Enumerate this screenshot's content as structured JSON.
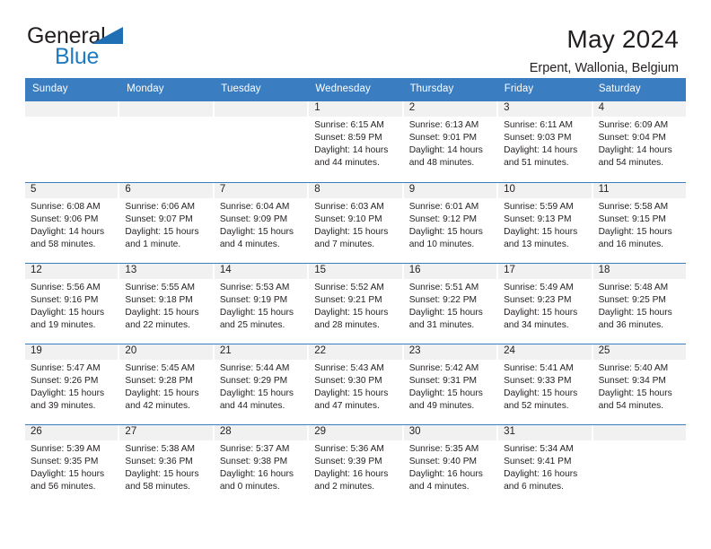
{
  "brand": {
    "name_part1": "General",
    "name_part2": "Blue",
    "triangle_color": "#1f6fb5",
    "blue_color": "#1f7ac0"
  },
  "header": {
    "title": "May 2024",
    "subtitle": "Erpent, Wallonia, Belgium"
  },
  "theme": {
    "header_bar_color": "#3a7dc0",
    "day_band_color": "#f1f1f1",
    "text_color": "#231f20"
  },
  "weekdays": [
    "Sunday",
    "Monday",
    "Tuesday",
    "Wednesday",
    "Thursday",
    "Friday",
    "Saturday"
  ],
  "weeks": [
    [
      {
        "day": "",
        "sunrise": "",
        "sunset": "",
        "daylight1": "",
        "daylight2": ""
      },
      {
        "day": "",
        "sunrise": "",
        "sunset": "",
        "daylight1": "",
        "daylight2": ""
      },
      {
        "day": "",
        "sunrise": "",
        "sunset": "",
        "daylight1": "",
        "daylight2": ""
      },
      {
        "day": "1",
        "sunrise": "Sunrise: 6:15 AM",
        "sunset": "Sunset: 8:59 PM",
        "daylight1": "Daylight: 14 hours",
        "daylight2": "and 44 minutes."
      },
      {
        "day": "2",
        "sunrise": "Sunrise: 6:13 AM",
        "sunset": "Sunset: 9:01 PM",
        "daylight1": "Daylight: 14 hours",
        "daylight2": "and 48 minutes."
      },
      {
        "day": "3",
        "sunrise": "Sunrise: 6:11 AM",
        "sunset": "Sunset: 9:03 PM",
        "daylight1": "Daylight: 14 hours",
        "daylight2": "and 51 minutes."
      },
      {
        "day": "4",
        "sunrise": "Sunrise: 6:09 AM",
        "sunset": "Sunset: 9:04 PM",
        "daylight1": "Daylight: 14 hours",
        "daylight2": "and 54 minutes."
      }
    ],
    [
      {
        "day": "5",
        "sunrise": "Sunrise: 6:08 AM",
        "sunset": "Sunset: 9:06 PM",
        "daylight1": "Daylight: 14 hours",
        "daylight2": "and 58 minutes."
      },
      {
        "day": "6",
        "sunrise": "Sunrise: 6:06 AM",
        "sunset": "Sunset: 9:07 PM",
        "daylight1": "Daylight: 15 hours",
        "daylight2": "and 1 minute."
      },
      {
        "day": "7",
        "sunrise": "Sunrise: 6:04 AM",
        "sunset": "Sunset: 9:09 PM",
        "daylight1": "Daylight: 15 hours",
        "daylight2": "and 4 minutes."
      },
      {
        "day": "8",
        "sunrise": "Sunrise: 6:03 AM",
        "sunset": "Sunset: 9:10 PM",
        "daylight1": "Daylight: 15 hours",
        "daylight2": "and 7 minutes."
      },
      {
        "day": "9",
        "sunrise": "Sunrise: 6:01 AM",
        "sunset": "Sunset: 9:12 PM",
        "daylight1": "Daylight: 15 hours",
        "daylight2": "and 10 minutes."
      },
      {
        "day": "10",
        "sunrise": "Sunrise: 5:59 AM",
        "sunset": "Sunset: 9:13 PM",
        "daylight1": "Daylight: 15 hours",
        "daylight2": "and 13 minutes."
      },
      {
        "day": "11",
        "sunrise": "Sunrise: 5:58 AM",
        "sunset": "Sunset: 9:15 PM",
        "daylight1": "Daylight: 15 hours",
        "daylight2": "and 16 minutes."
      }
    ],
    [
      {
        "day": "12",
        "sunrise": "Sunrise: 5:56 AM",
        "sunset": "Sunset: 9:16 PM",
        "daylight1": "Daylight: 15 hours",
        "daylight2": "and 19 minutes."
      },
      {
        "day": "13",
        "sunrise": "Sunrise: 5:55 AM",
        "sunset": "Sunset: 9:18 PM",
        "daylight1": "Daylight: 15 hours",
        "daylight2": "and 22 minutes."
      },
      {
        "day": "14",
        "sunrise": "Sunrise: 5:53 AM",
        "sunset": "Sunset: 9:19 PM",
        "daylight1": "Daylight: 15 hours",
        "daylight2": "and 25 minutes."
      },
      {
        "day": "15",
        "sunrise": "Sunrise: 5:52 AM",
        "sunset": "Sunset: 9:21 PM",
        "daylight1": "Daylight: 15 hours",
        "daylight2": "and 28 minutes."
      },
      {
        "day": "16",
        "sunrise": "Sunrise: 5:51 AM",
        "sunset": "Sunset: 9:22 PM",
        "daylight1": "Daylight: 15 hours",
        "daylight2": "and 31 minutes."
      },
      {
        "day": "17",
        "sunrise": "Sunrise: 5:49 AM",
        "sunset": "Sunset: 9:23 PM",
        "daylight1": "Daylight: 15 hours",
        "daylight2": "and 34 minutes."
      },
      {
        "day": "18",
        "sunrise": "Sunrise: 5:48 AM",
        "sunset": "Sunset: 9:25 PM",
        "daylight1": "Daylight: 15 hours",
        "daylight2": "and 36 minutes."
      }
    ],
    [
      {
        "day": "19",
        "sunrise": "Sunrise: 5:47 AM",
        "sunset": "Sunset: 9:26 PM",
        "daylight1": "Daylight: 15 hours",
        "daylight2": "and 39 minutes."
      },
      {
        "day": "20",
        "sunrise": "Sunrise: 5:45 AM",
        "sunset": "Sunset: 9:28 PM",
        "daylight1": "Daylight: 15 hours",
        "daylight2": "and 42 minutes."
      },
      {
        "day": "21",
        "sunrise": "Sunrise: 5:44 AM",
        "sunset": "Sunset: 9:29 PM",
        "daylight1": "Daylight: 15 hours",
        "daylight2": "and 44 minutes."
      },
      {
        "day": "22",
        "sunrise": "Sunrise: 5:43 AM",
        "sunset": "Sunset: 9:30 PM",
        "daylight1": "Daylight: 15 hours",
        "daylight2": "and 47 minutes."
      },
      {
        "day": "23",
        "sunrise": "Sunrise: 5:42 AM",
        "sunset": "Sunset: 9:31 PM",
        "daylight1": "Daylight: 15 hours",
        "daylight2": "and 49 minutes."
      },
      {
        "day": "24",
        "sunrise": "Sunrise: 5:41 AM",
        "sunset": "Sunset: 9:33 PM",
        "daylight1": "Daylight: 15 hours",
        "daylight2": "and 52 minutes."
      },
      {
        "day": "25",
        "sunrise": "Sunrise: 5:40 AM",
        "sunset": "Sunset: 9:34 PM",
        "daylight1": "Daylight: 15 hours",
        "daylight2": "and 54 minutes."
      }
    ],
    [
      {
        "day": "26",
        "sunrise": "Sunrise: 5:39 AM",
        "sunset": "Sunset: 9:35 PM",
        "daylight1": "Daylight: 15 hours",
        "daylight2": "and 56 minutes."
      },
      {
        "day": "27",
        "sunrise": "Sunrise: 5:38 AM",
        "sunset": "Sunset: 9:36 PM",
        "daylight1": "Daylight: 15 hours",
        "daylight2": "and 58 minutes."
      },
      {
        "day": "28",
        "sunrise": "Sunrise: 5:37 AM",
        "sunset": "Sunset: 9:38 PM",
        "daylight1": "Daylight: 16 hours",
        "daylight2": "and 0 minutes."
      },
      {
        "day": "29",
        "sunrise": "Sunrise: 5:36 AM",
        "sunset": "Sunset: 9:39 PM",
        "daylight1": "Daylight: 16 hours",
        "daylight2": "and 2 minutes."
      },
      {
        "day": "30",
        "sunrise": "Sunrise: 5:35 AM",
        "sunset": "Sunset: 9:40 PM",
        "daylight1": "Daylight: 16 hours",
        "daylight2": "and 4 minutes."
      },
      {
        "day": "31",
        "sunrise": "Sunrise: 5:34 AM",
        "sunset": "Sunset: 9:41 PM",
        "daylight1": "Daylight: 16 hours",
        "daylight2": "and 6 minutes."
      },
      {
        "day": "",
        "sunrise": "",
        "sunset": "",
        "daylight1": "",
        "daylight2": ""
      }
    ]
  ]
}
